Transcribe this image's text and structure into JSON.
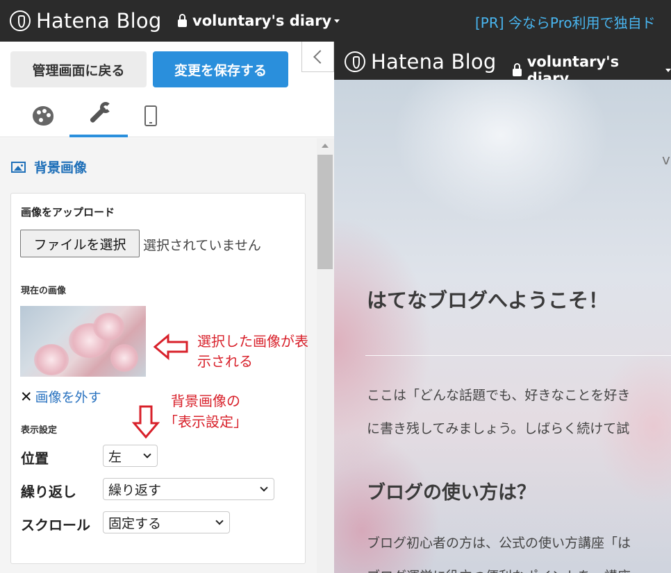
{
  "topbar": {
    "logo": "Hatena Blog",
    "blog_name": "voluntary's diary",
    "promo": "[PR] 今ならPro利用で独自ド"
  },
  "toolbar": {
    "back_label": "管理画面に戻る",
    "save_label": "変更を保存する"
  },
  "tabs": [
    "design-palette",
    "customize-wrench",
    "smartphone"
  ],
  "section": {
    "title": "背景画像",
    "upload_label": "画像をアップロード",
    "file_button": "ファイルを選択",
    "file_status": "選択されていません",
    "current_label": "現在の画像",
    "remove_label": "画像を外す",
    "display_label": "表示設定",
    "position_label": "位置",
    "position_value": "左",
    "repeat_label": "繰り返し",
    "repeat_value": "繰り返す",
    "scroll_label": "スクロール",
    "scroll_value": "固定する"
  },
  "annotations": {
    "image_note_line1": "選択した画像が表",
    "image_note_line2": "示される",
    "display_note_line1": "背景画像の",
    "display_note_line2": "「表示設定」"
  },
  "preview": {
    "logo": "Hatena Blog",
    "blog_name": "voluntary's diary",
    "corner_char": "v",
    "welcome": "はてなブログへようこそ！",
    "para1_line1": "ここは「どんな話題でも、好きなことを好き",
    "para1_line2": "に書き残してみましょう。しばらく続けて試",
    "howto": "ブログの使い方は？",
    "para2_line1": "ブログ初心者の方は、公式の使い方講座「は",
    "para2_line2": "ブログ運営に役立つ便利なポイントを、講座"
  },
  "colors": {
    "topbar_bg": "#2b2b2b",
    "save_button": "#2a8fdc",
    "link": "#2a73c0",
    "annotation": "#d8202a",
    "promo": "#49b6f0"
  }
}
